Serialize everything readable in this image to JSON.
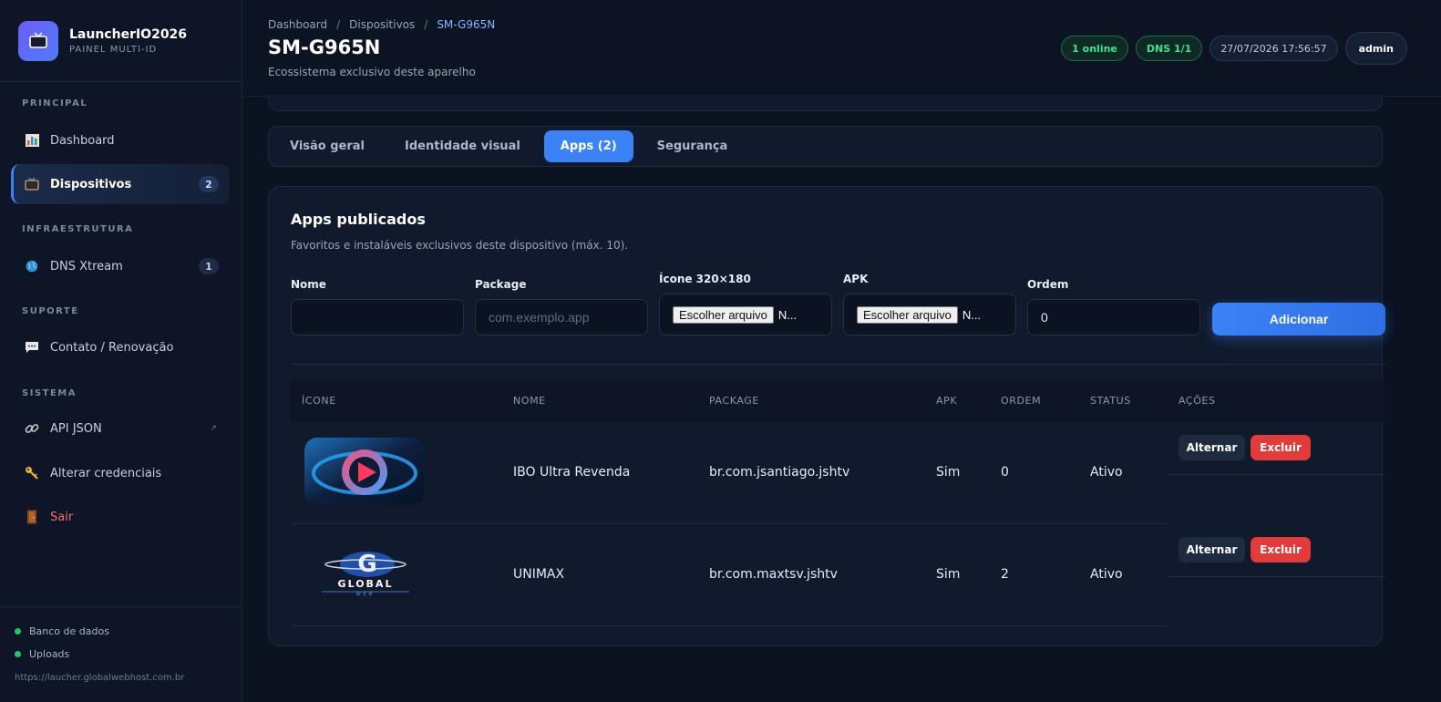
{
  "brand": {
    "title": "LauncherIO2026",
    "subtitle": "PAINEL MULTI-ID",
    "icon": "tv-icon"
  },
  "sidebar": {
    "sections": {
      "principal": "PRINCIPAL",
      "infra": "INFRAESTRUTURA",
      "suporte": "SUPORTE",
      "sistema": "SISTEMA"
    },
    "items": [
      {
        "label": "Dashboard",
        "icon": "bar-chart-icon"
      },
      {
        "label": "Dispositivos",
        "icon": "tv-icon",
        "badge": "2"
      },
      {
        "label": "DNS Xtream",
        "icon": "globe-icon",
        "badge": "1"
      },
      {
        "label": "Contato / Renovação",
        "icon": "chat-icon"
      },
      {
        "label": "API JSON",
        "icon": "link-icon",
        "ext": "↗"
      },
      {
        "label": "Alterar credenciais",
        "icon": "key-icon"
      },
      {
        "label": "Sair",
        "icon": "door-icon"
      }
    ],
    "status": [
      "Banco de dados",
      "Uploads"
    ],
    "url": "https://laucher.globalwebhost.com.br"
  },
  "header": {
    "breadcrumb": [
      "Dashboard",
      "Dispositivos",
      "SM-G965N"
    ],
    "title": "SM-G965N",
    "subtitle": "Ecossistema exclusivo deste aparelho",
    "online": "1 online",
    "dns": "DNS 1/1",
    "datetime": "27/07/2026 17:56:57",
    "user": "admin"
  },
  "tabs": [
    "Visão geral",
    "Identidade visual",
    "Apps (2)",
    "Segurança"
  ],
  "apps": {
    "title": "Apps publicados",
    "subtitle": "Favoritos e instaláveis exclusivos deste dispositivo (máx. 10).",
    "form": {
      "nome_label": "Nome",
      "package_label": "Package",
      "package_placeholder": "com.exemplo.app",
      "icone_label": "Ícone 320×180",
      "apk_label": "APK",
      "ordem_label": "Ordem",
      "ordem_value": "0",
      "file_button": "Escolher arquivo",
      "file_rest": "N...",
      "add_button": "Adicionar"
    },
    "columns": [
      "ÍCONE",
      "NOME",
      "PACKAGE",
      "APK",
      "ORDEM",
      "STATUS",
      "AÇÕES"
    ],
    "rows": [
      {
        "icon": "play-logo-icon",
        "nome": "IBO Ultra Revenda",
        "package": "br.com.jsantiago.jshtv",
        "apk": "Sim",
        "ordem": "0",
        "status": "Ativo"
      },
      {
        "icon": "global-web-logo-icon",
        "logo_text": "GLOBAL",
        "logo_sub": "WEB",
        "nome": "UNIMAX",
        "package": "br.com.maxtsv.jshtv",
        "apk": "Sim",
        "ordem": "2",
        "status": "Ativo"
      }
    ],
    "actions": {
      "toggle": "Alternar",
      "delete": "Excluir"
    }
  }
}
